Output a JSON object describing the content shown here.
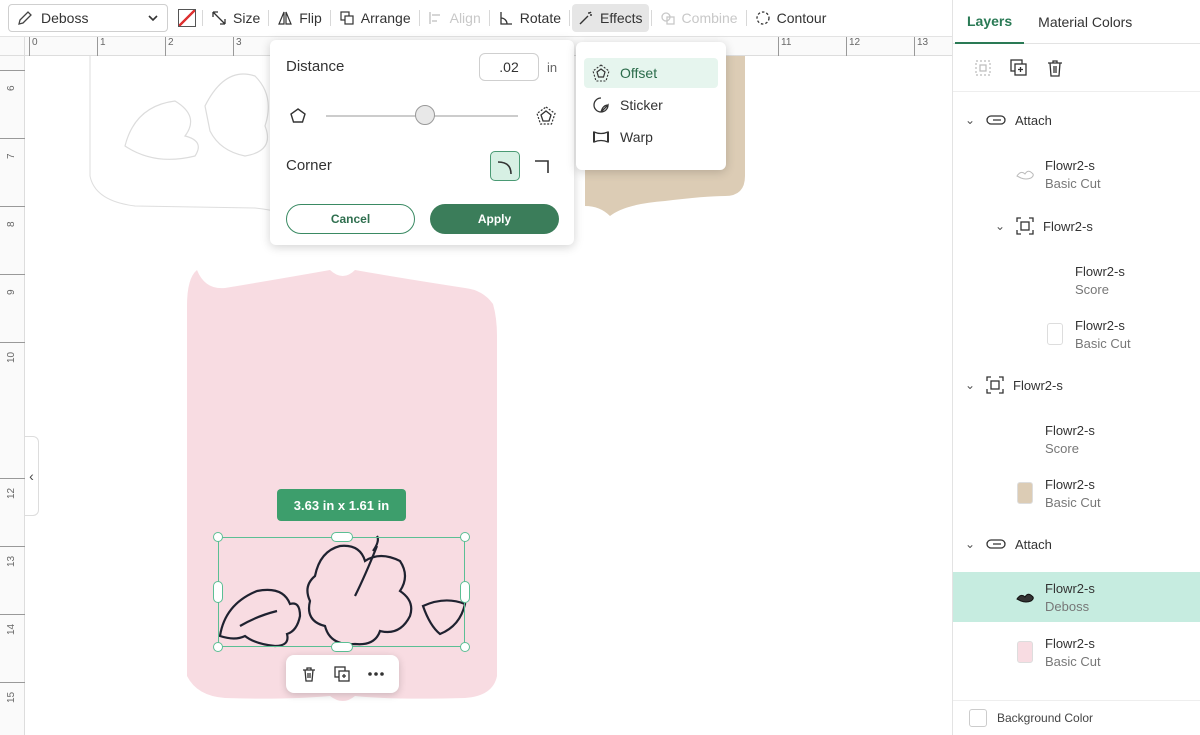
{
  "toolbar": {
    "operation": "Deboss",
    "size": "Size",
    "flip": "Flip",
    "arrange": "Arrange",
    "align": "Align",
    "rotate": "Rotate",
    "effects": "Effects",
    "combine": "Combine",
    "contour": "Contour"
  },
  "ruler": {
    "h": [
      "0",
      "1",
      "2",
      "3",
      "11",
      "12",
      "13"
    ],
    "v": [
      "6",
      "7",
      "8",
      "9",
      "10",
      "12",
      "13",
      "14",
      "15"
    ]
  },
  "offset_panel": {
    "distance_label": "Distance",
    "distance_value": ".02",
    "distance_unit": "in",
    "corner_label": "Corner",
    "cancel": "Cancel",
    "apply": "Apply",
    "slider_level": 0.51
  },
  "effects_menu": {
    "items": [
      "Offset",
      "Sticker",
      "Warp"
    ]
  },
  "selection": {
    "size_label": "3.63  in x 1.61  in"
  },
  "right_panel": {
    "tabs": [
      "Layers",
      "Material Colors"
    ],
    "layers": [
      {
        "name": "Attach"
      },
      {
        "name": "Flowr2-s",
        "op": "Basic Cut"
      },
      {
        "name": "Flowr2-s"
      },
      {
        "name": "Flowr2-s",
        "op": "Score"
      },
      {
        "name": "Flowr2-s",
        "op": "Basic Cut"
      },
      {
        "name": "Flowr2-s"
      },
      {
        "name": "Flowr2-s",
        "op": "Score"
      },
      {
        "name": "Flowr2-s",
        "op": "Basic Cut"
      },
      {
        "name": "Attach"
      },
      {
        "name": "Flowr2-s",
        "op": "Deboss"
      },
      {
        "name": "Flowr2-s",
        "op": "Basic Cut"
      }
    ],
    "background_color": "Background Color"
  },
  "colors": {
    "accent": "#3b7d5a",
    "selection": "#5bbf94",
    "pink_card": "#f8dce2",
    "tan_card": "#dcccb5"
  }
}
